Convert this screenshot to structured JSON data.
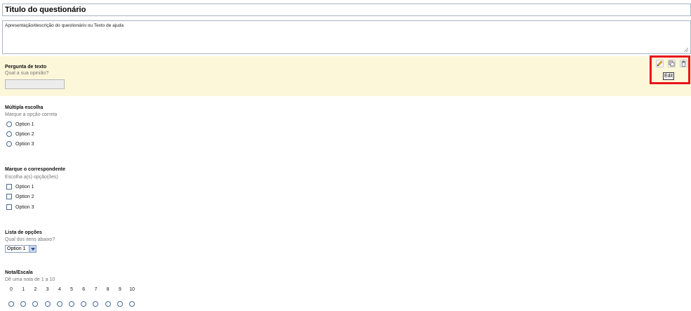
{
  "form": {
    "title": "Titulo do questionário",
    "description": "Apresentação/descrição do questionário ou Texto de ajuda"
  },
  "questions": {
    "text": {
      "title": "Pergunta de texto",
      "help": "Qual a sua opinião?"
    },
    "multiple_choice": {
      "title": "Múltipla escolha",
      "help": "Marque a opção correta",
      "options": [
        "Option 1",
        "Option 2",
        "Option 3"
      ]
    },
    "checkboxes": {
      "title": "Marque o correspondente",
      "help": "Escolha a(s) opção(ões)",
      "options": [
        "Option 1",
        "Option 2",
        "Option 3"
      ]
    },
    "list": {
      "title": "Lista de opções",
      "help": "Qual dos itens abaixo?",
      "selected": "Option 1"
    },
    "scale": {
      "title": "Nota/Escala",
      "help": "Dê uma nota de 1 a 10",
      "values": [
        "0",
        "1",
        "2",
        "3",
        "4",
        "5",
        "6",
        "7",
        "8",
        "9",
        "10"
      ]
    }
  },
  "toolbar": {
    "edit_icon": "pencil-icon",
    "duplicate_icon": "duplicate-icon",
    "delete_icon": "trash-icon",
    "tooltip": "Edit"
  },
  "colors": {
    "active_question_bg": "#fdf7da",
    "highlight_border": "#e8141a",
    "input_border": "#a7b5c6"
  }
}
